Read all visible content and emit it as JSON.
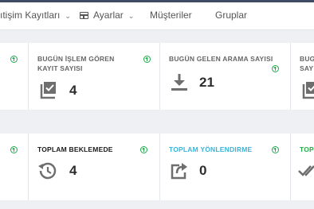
{
  "nav": {
    "item1": "ıtişim Kayıtları",
    "item2": "Ayarlar",
    "item3": "Müşteriler",
    "item4": "Gruplar"
  },
  "row1": {
    "card0": {
      "title": ""
    },
    "card1": {
      "title": "BUGÜN İŞLEM GÖREN KAYIT SAYISI",
      "value": "4"
    },
    "card2": {
      "title": "BUGÜN GELEN ARAMA SAYISI",
      "value": "21"
    },
    "card3": {
      "title": "BUG SAY"
    }
  },
  "row2": {
    "card1": {
      "title": "TOPLAM BEKLEMEDE",
      "value": "4"
    },
    "card2": {
      "title": "TOPLAM YÖNLENDIRME",
      "value": "0"
    },
    "card3": {
      "title": "TOP"
    }
  },
  "icons": {
    "trend": "arrow-up-circle-icon",
    "card_r1c1": "checkbox-stack-icon",
    "card_r1c2": "download-icon",
    "card_r1c3": "checkbox-stack-icon",
    "card_r2c1": "history-icon",
    "card_r2c2": "forward-share-icon",
    "card_r2c3": "double-check-icon"
  },
  "colors": {
    "trend_green": "#1fa84a",
    "blue_title": "#3cb2d6",
    "green_title": "#2aa84a"
  }
}
